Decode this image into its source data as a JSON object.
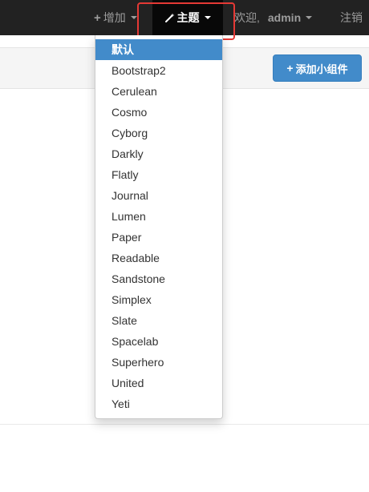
{
  "navbar": {
    "add_label": "增加",
    "theme_label": "主题",
    "welcome_label": "欢迎,",
    "user_label": "admin",
    "logout_label": "注销"
  },
  "toolbar": {
    "add_widget_label": "添加小组件"
  },
  "theme_menu": {
    "selected": "默认",
    "items": [
      {
        "label": "默认"
      },
      {
        "label": "Bootstrap2"
      },
      {
        "label": "Cerulean"
      },
      {
        "label": "Cosmo"
      },
      {
        "label": "Cyborg"
      },
      {
        "label": "Darkly"
      },
      {
        "label": "Flatly"
      },
      {
        "label": "Journal"
      },
      {
        "label": "Lumen"
      },
      {
        "label": "Paper"
      },
      {
        "label": "Readable"
      },
      {
        "label": "Sandstone"
      },
      {
        "label": "Simplex"
      },
      {
        "label": "Slate"
      },
      {
        "label": "Spacelab"
      },
      {
        "label": "Superhero"
      },
      {
        "label": "United"
      },
      {
        "label": "Yeti"
      }
    ]
  },
  "colors": {
    "navbar_bg": "#222222",
    "accent": "#428bca",
    "highlight_outline": "#e53935"
  }
}
